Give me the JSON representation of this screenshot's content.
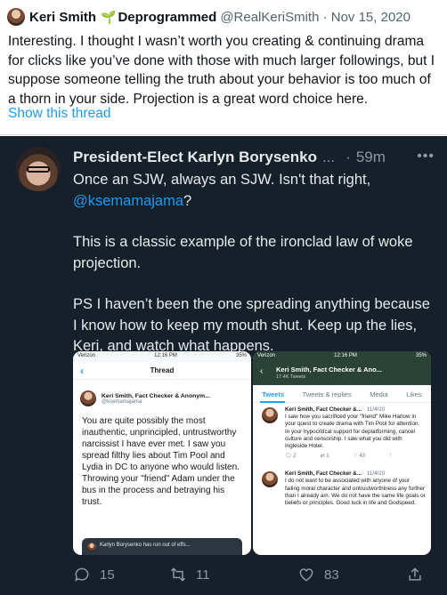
{
  "top_tweet": {
    "name": "Keri Smith",
    "name2": "Deprogrammed",
    "handle": "@RealKeriSmith",
    "date": "Nov 15, 2020",
    "text": "Interesting. I thought I wasn’t worth you creating & continuing drama for clicks like you’ve done with those with much larger followings, but I suppose someone telling the truth about your behavior is too much of a thorn in your side. Projection is a great word choice here.",
    "show_thread": "Show this thread"
  },
  "main_tweet": {
    "name": "President-Elect Karlyn Borysenko",
    "more": "...",
    "time": "59m",
    "p1_a": "Once an SJW, always an SJW. Isn't that right,",
    "p1_mention": "@ksemamajama",
    "p1_b": "?",
    "p2": "This is a classic example of the ironclad law of woke projection.",
    "p3": "PS I haven’t been the one spreading anything because I know how to keep my mouth shut. Keep up the lies, Keri, and watch what happens.",
    "replies": "15",
    "retweets": "11",
    "likes": "83"
  },
  "shot1": {
    "carrier": "Verizon",
    "time": "12:16 PM",
    "battery": "35%",
    "title": "Thread",
    "user": "Keri Smith, Fact Checker & Anonym...",
    "handle": "@ksemamajama",
    "body": "You are quite possibly the most inauthentic, unprincipled, untrustworthy narcissist I have ever met. I saw you spread filthy lies about Tim Pool and Lydia in DC to anyone who would listen. Throwing your \"friend\" Adam under the bus in the process and betraying his trust.",
    "quote": "Karlyn Borysenko has run out of effs..."
  },
  "shot2": {
    "carrier": "Verizon",
    "time": "12:16 PM",
    "battery": "35%",
    "name": "Keri Smith, Fact Checker & Ano...",
    "count": "17.4K Tweets",
    "tabs": [
      "Tweets",
      "Tweets & replies",
      "Media",
      "Likes"
    ],
    "tweets": [
      {
        "name": "Keri Smith, Fact Checker &...",
        "date": "11/4/20",
        "text": "I saw how you sacrificed your \"friend\" Mike Harlow in your quest to create drama with Tim Pool for attention. In your hypocritical support for deplatforming, cancel culture and censorship. I saw what you did with Ingleside Hotel.",
        "r": "2",
        "rt": "1",
        "l": "43"
      },
      {
        "name": "Keri Smith, Fact Checker &...",
        "date": "11/4/20",
        "text": "I do not want to be associated with anyone of your failing moral character and untrustworthiness any further than I already am. We do not have the same life goals or beliefs or principles. Good luck in life and Godspeed.",
        "r": "",
        "rt": "",
        "l": ""
      }
    ]
  },
  "colors": {
    "dark_bg": "#15202b",
    "link": "#1d9bf0",
    "muted": "#8b98a5"
  }
}
